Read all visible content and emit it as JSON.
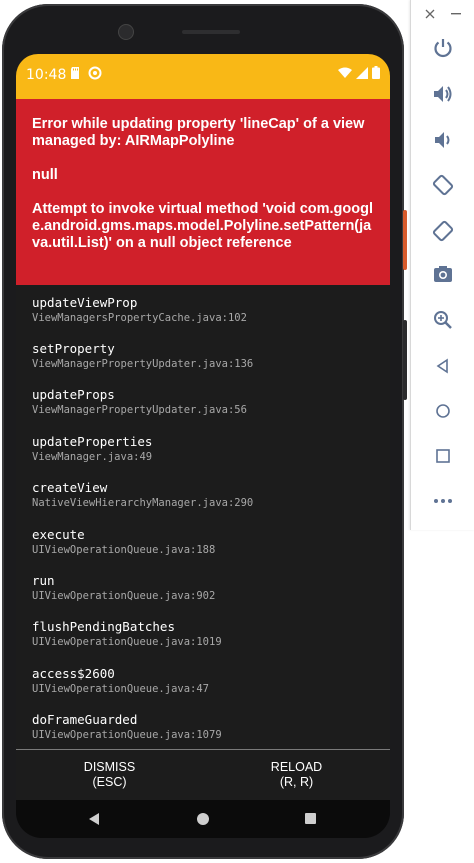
{
  "status": {
    "time": "10:48"
  },
  "error": {
    "title": "Error while updating property 'lineCap' of a view managed by: AIRMapPolyline",
    "value": "null",
    "detail": "Attempt to invoke virtual method 'void com.google.android.gms.maps.model.Polyline.setPattern(java.util.List)' on a null object reference"
  },
  "stack": [
    {
      "method": "updateViewProp",
      "location": "ViewManagersPropertyCache.java:102"
    },
    {
      "method": "setProperty",
      "location": "ViewManagerPropertyUpdater.java:136"
    },
    {
      "method": "updateProps",
      "location": "ViewManagerPropertyUpdater.java:56"
    },
    {
      "method": "updateProperties",
      "location": "ViewManager.java:49"
    },
    {
      "method": "createView",
      "location": "NativeViewHierarchyManager.java:290"
    },
    {
      "method": "execute",
      "location": "UIViewOperationQueue.java:188"
    },
    {
      "method": "run",
      "location": "UIViewOperationQueue.java:902"
    },
    {
      "method": "flushPendingBatches",
      "location": "UIViewOperationQueue.java:1019"
    },
    {
      "method": "access$2600",
      "location": "UIViewOperationQueue.java:47"
    },
    {
      "method": "doFrameGuarded",
      "location": "UIViewOperationQueue.java:1079"
    }
  ],
  "buttons": {
    "dismiss": "DISMISS",
    "dismiss_key": "(ESC)",
    "reload": "RELOAD",
    "reload_key": "(R, R)"
  },
  "toolbar": {
    "icons": [
      "close-icon",
      "minimize-icon",
      "power-icon",
      "volume-up-icon",
      "volume-down-icon",
      "rotate-left-icon",
      "rotate-right-icon",
      "camera-icon",
      "zoom-icon",
      "back-icon",
      "home-icon",
      "overview-icon",
      "more-icon"
    ]
  },
  "colors": {
    "statusbar": "#f9b816",
    "error_red": "#d0202a",
    "stack_bg": "#1c1c1c",
    "toolbar_icon": "#6a7b9a"
  }
}
